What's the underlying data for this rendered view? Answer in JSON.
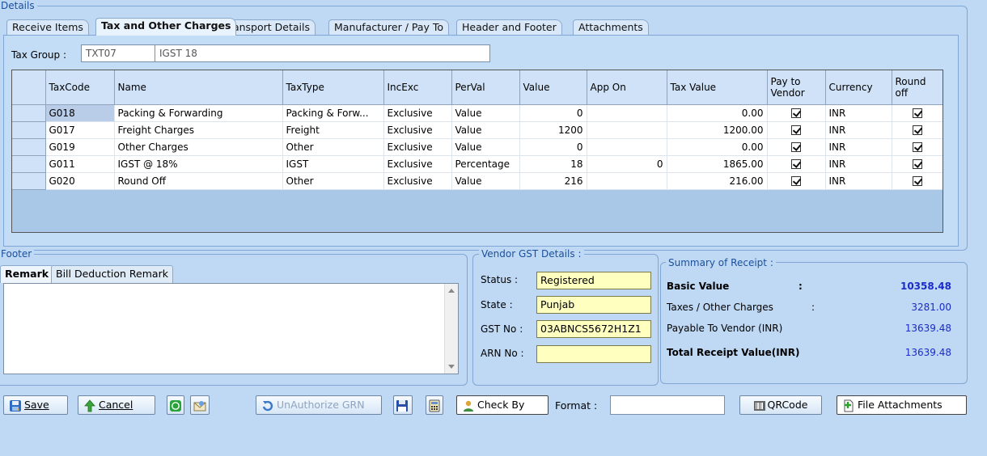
{
  "details": {
    "legend": "Details",
    "tabs": [
      "Receive Items",
      "Tax and Other Charges",
      "Transport Details",
      "Manufacturer / Pay To",
      "Header and Footer",
      "Attachments"
    ],
    "active_tab": 1
  },
  "tax_group": {
    "label": "Tax Group :",
    "code": "TXT07",
    "name": "IGST 18"
  },
  "grid": {
    "headers": [
      "TaxCode",
      "Name",
      "TaxType",
      "IncExc",
      "PerVal",
      "Value",
      "App On",
      "Tax Value",
      "Pay to Vendor",
      "Currency",
      "Round off"
    ],
    "rows": [
      {
        "code": "G018",
        "name": "Packing & Forwarding",
        "type": "Packing & Forw...",
        "incexc": "Exclusive",
        "perval": "Value",
        "value": "0",
        "appon": "",
        "taxvalue": "0.00",
        "pay": true,
        "currency": "INR",
        "round": true
      },
      {
        "code": "G017",
        "name": "Freight  Charges",
        "type": "Freight",
        "incexc": "Exclusive",
        "perval": "Value",
        "value": "1200",
        "appon": "",
        "taxvalue": "1200.00",
        "pay": true,
        "currency": "INR",
        "round": true
      },
      {
        "code": "G019",
        "name": "Other Charges",
        "type": "Other",
        "incexc": "Exclusive",
        "perval": "Value",
        "value": "0",
        "appon": "",
        "taxvalue": "0.00",
        "pay": true,
        "currency": "INR",
        "round": true
      },
      {
        "code": "G011",
        "name": "IGST @ 18%",
        "type": "IGST",
        "incexc": "Exclusive",
        "perval": "Percentage",
        "value": "18",
        "appon": "0",
        "taxvalue": "1865.00",
        "pay": true,
        "currency": "INR",
        "round": true
      },
      {
        "code": "G020",
        "name": "Round Off",
        "type": "Other",
        "incexc": "Exclusive",
        "perval": "Value",
        "value": "216",
        "appon": "",
        "taxvalue": "216.00",
        "pay": true,
        "currency": "INR",
        "round": true
      }
    ]
  },
  "footer": {
    "legend": "Footer",
    "tabs": [
      "Remark",
      "Bill Deduction Remark"
    ],
    "remark": ""
  },
  "vendor_gst": {
    "legend": "Vendor GST Details :",
    "status_label": "Status :",
    "status": "Registered",
    "state_label": "State :",
    "state": "Punjab",
    "gst_label": "GST No :",
    "gst": "03ABNCS5672H1Z1",
    "arn_label": "ARN No :",
    "arn": ""
  },
  "summary": {
    "legend": "Summary of Receipt :",
    "basic_label": "Basic Value",
    "basic_colon": ":",
    "basic": "10358.48",
    "taxes_label": "Taxes / Other Charges",
    "taxes_colon": ":",
    "taxes": "3281.00",
    "payable_label": "Payable To Vendor (INR)",
    "payable": "13639.48",
    "total_label": "Total Receipt Value(INR)",
    "total": "13639.48"
  },
  "buttons": {
    "save": "Save",
    "cancel": "Cancel",
    "unauthorize": "UnAuthorize GRN",
    "check_by": "Check By",
    "format_label": "Format :",
    "format_value": "",
    "qrcode": "QRCode",
    "file_attachments": "File Attachments"
  },
  "colors": {
    "background": "#bfd9f5",
    "accent_blue": "#1a2bc8",
    "gst_field": "#ffffc0"
  }
}
